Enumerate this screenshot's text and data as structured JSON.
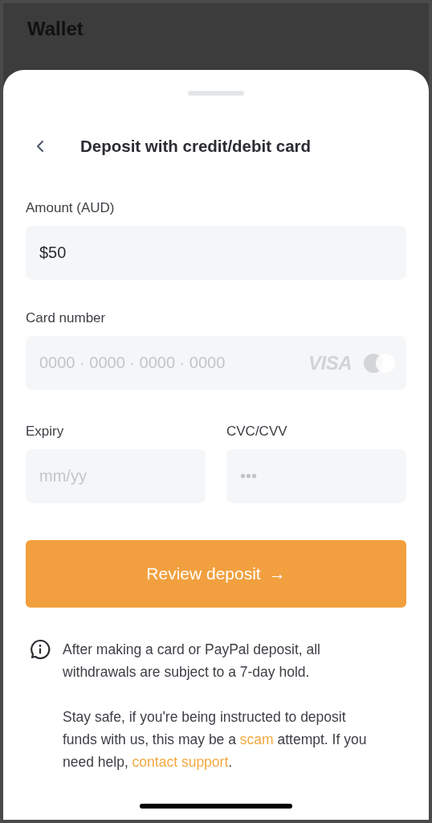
{
  "background": {
    "title": "Wallet"
  },
  "sheet": {
    "title": "Deposit with credit/debit card"
  },
  "amount": {
    "label": "Amount (AUD)",
    "value": "$50"
  },
  "card_number": {
    "label": "Card number",
    "placeholder": "0000 · 0000 · 0000 · 0000",
    "brand": "VISA"
  },
  "expiry": {
    "label": "Expiry",
    "placeholder": "mm/yy"
  },
  "cvc": {
    "label": "CVC/CVV",
    "placeholder": "•••"
  },
  "submit": {
    "label": "Review deposit",
    "arrow": "→"
  },
  "notice": {
    "paragraphs": [
      [
        {
          "kind": "text",
          "text": "After making a card or PayPal deposit, all withdrawals are subject to a 7-day hold."
        }
      ],
      [
        {
          "kind": "text",
          "text": "Stay safe, if you're being instructed to deposit funds with us, this may be a "
        },
        {
          "kind": "link",
          "text": "scam"
        },
        {
          "kind": "text",
          "text": " attempt. If you need help, "
        },
        {
          "kind": "link",
          "text": "contact support"
        },
        {
          "kind": "text",
          "text": "."
        }
      ]
    ]
  }
}
